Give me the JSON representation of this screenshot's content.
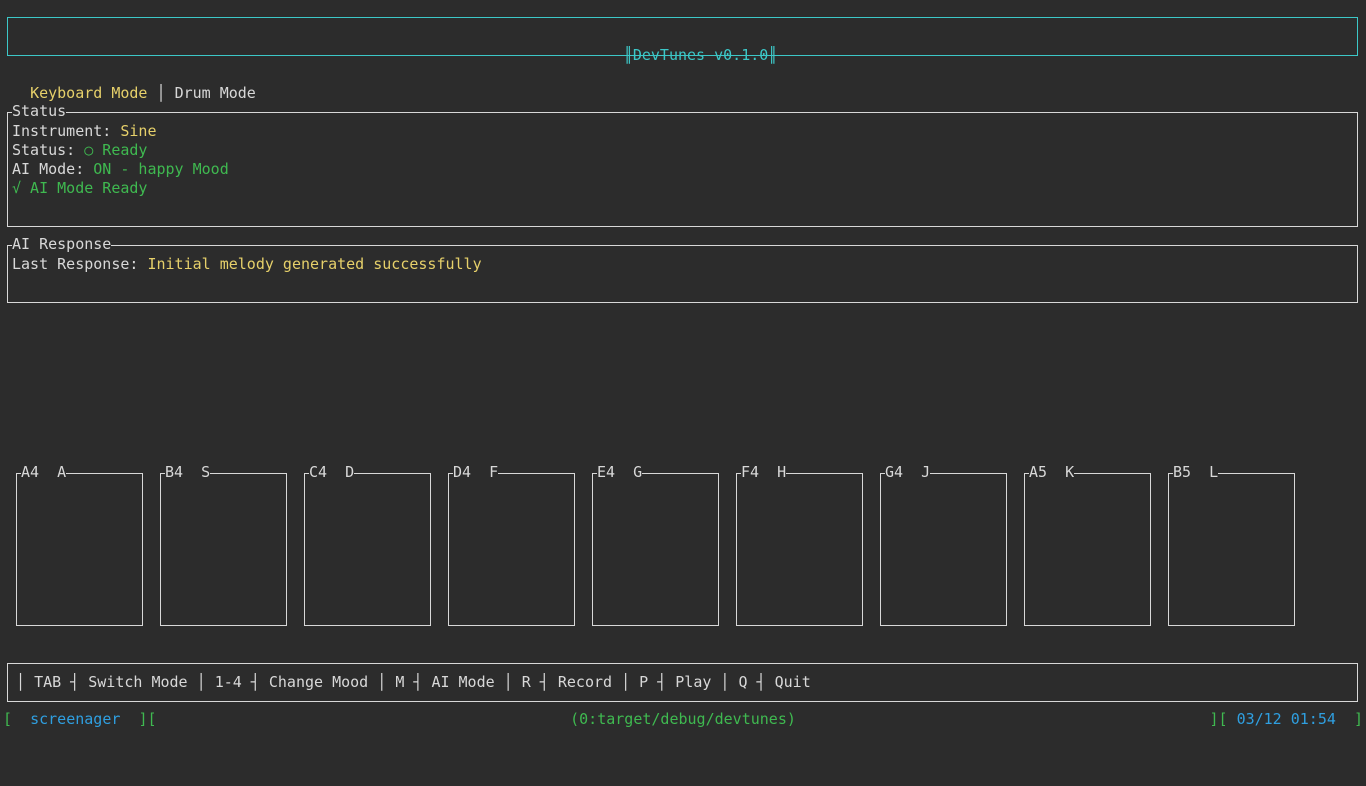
{
  "header": {
    "title": "DevTunes v0.1.0",
    "border_color": "#3cc8c8"
  },
  "tabs": [
    {
      "label": "Keyboard Mode",
      "active": true
    },
    {
      "label": "Drum Mode",
      "active": false
    }
  ],
  "status_panel": {
    "title": "Status",
    "instrument_label": "Instrument: ",
    "instrument_value": "Sine",
    "status_label": "Status: ",
    "status_value": "○ Ready",
    "ai_mode_label": "AI Mode: ",
    "ai_mode_value": "ON - happy Mood",
    "ai_ready": "√ AI Mode Ready"
  },
  "ai_response_panel": {
    "title": "AI Response",
    "last_response_label": "Last Response: ",
    "last_response_value": "Initial melody generated successfully"
  },
  "keys": [
    {
      "label": "A4  A"
    },
    {
      "label": "B4  S"
    },
    {
      "label": "C4  D"
    },
    {
      "label": "D4  F"
    },
    {
      "label": "E4  G"
    },
    {
      "label": "F4  H"
    },
    {
      "label": "G4  J"
    },
    {
      "label": "A5  K"
    },
    {
      "label": "B5  L"
    }
  ],
  "shortcuts": [
    {
      "key": "TAB",
      "action": "Switch Mode"
    },
    {
      "key": "1-4",
      "action": "Change Mood"
    },
    {
      "key": "M",
      "action": "AI Mode"
    },
    {
      "key": "R",
      "action": "Record"
    },
    {
      "key": "P",
      "action": "Play"
    },
    {
      "key": "Q",
      "action": "Quit"
    }
  ],
  "tmux": {
    "session": "screenager",
    "window": "(0:target/debug/devtunes)",
    "datetime": "03/12 01:54"
  },
  "colors": {
    "background": "#2c2c2c",
    "accent_yellow": "#e6d06a",
    "accent_green": "#3fb950",
    "accent_cyan": "#3cc8c8",
    "accent_blue": "#2f9fe0"
  }
}
